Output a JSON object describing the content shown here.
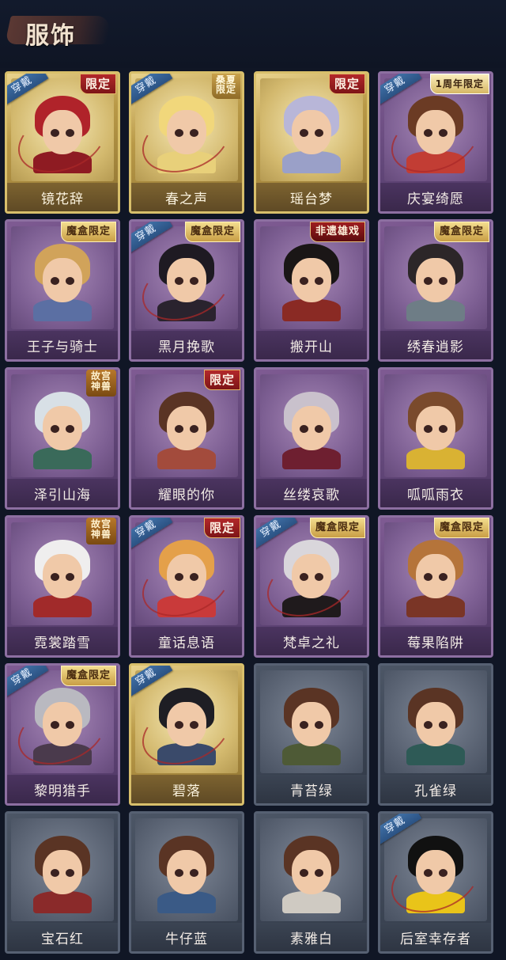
{
  "header": {
    "title": "服饰"
  },
  "labels": {
    "wear": "穿戴"
  },
  "costumes": [
    {
      "name": "镜花辞",
      "frame": "gold",
      "worn": true,
      "badge": "限定",
      "badge_style": "red",
      "hair": "#b0232a",
      "outfit": "#8e1b22"
    },
    {
      "name": "春之声",
      "frame": "gold",
      "worn": true,
      "badge": "桑夏\n限定",
      "badge_style": "multi",
      "hair": "#f1d77b",
      "outfit": "#e8d07a"
    },
    {
      "name": "瑶台梦",
      "frame": "gold",
      "worn": false,
      "badge": "限定",
      "badge_style": "red",
      "hair": "#b8b6d8",
      "outfit": "#9aa0c8"
    },
    {
      "name": "庆宴绮愿",
      "frame": "purple",
      "worn": true,
      "badge": "1周年限定",
      "badge_style": "anniv",
      "hair": "#6b3b24",
      "outfit": "#c23d34"
    },
    {
      "name": "王子与骑士",
      "frame": "purple",
      "worn": false,
      "badge": "魔盒限定",
      "badge_style": "gold",
      "hair": "#d1a35a",
      "outfit": "#5b6fa3"
    },
    {
      "name": "黑月挽歌",
      "frame": "purple",
      "worn": true,
      "badge": "魔盒限定",
      "badge_style": "gold",
      "hair": "#1e1a22",
      "outfit": "#2a232e"
    },
    {
      "name": "搬开山",
      "frame": "purple",
      "worn": false,
      "badge": "非遗雄戏",
      "badge_style": "heritage",
      "hair": "#1a1616",
      "outfit": "#8a2a24"
    },
    {
      "name": "绣春逍影",
      "frame": "purple",
      "worn": false,
      "badge": "魔盒限定",
      "badge_style": "gold",
      "hair": "#2c2628",
      "outfit": "#6e7d86"
    },
    {
      "name": "泽引山海",
      "frame": "purple",
      "worn": false,
      "badge": "故宫\n神兽",
      "badge_style": "palace",
      "hair": "#d8e0e6",
      "outfit": "#3a6a5a"
    },
    {
      "name": "耀眼的你",
      "frame": "purple",
      "worn": false,
      "badge": "限定",
      "badge_style": "red",
      "hair": "#5a3424",
      "outfit": "#a34b3c"
    },
    {
      "name": "丝缕哀歌",
      "frame": "purple",
      "worn": false,
      "badge": "",
      "badge_style": "",
      "hair": "#c9c1cc",
      "outfit": "#6e1f30"
    },
    {
      "name": "呱呱雨衣",
      "frame": "purple",
      "worn": false,
      "badge": "",
      "badge_style": "",
      "hair": "#7a4a2c",
      "outfit": "#d9b233"
    },
    {
      "name": "霓裳踏雪",
      "frame": "purple",
      "worn": false,
      "badge": "故宫\n神兽",
      "badge_style": "palace",
      "hair": "#efeeee",
      "outfit": "#a12a2a"
    },
    {
      "name": "童话息语",
      "frame": "purple",
      "worn": true,
      "badge": "限定",
      "badge_style": "red",
      "hair": "#e4a04a",
      "outfit": "#c93a3a"
    },
    {
      "name": "梵卓之礼",
      "frame": "purple",
      "worn": true,
      "badge": "魔盒限定",
      "badge_style": "gold",
      "hair": "#d9d6db",
      "outfit": "#1f1a1c"
    },
    {
      "name": "莓果陷阱",
      "frame": "purple",
      "worn": false,
      "badge": "魔盒限定",
      "badge_style": "gold",
      "hair": "#b5743a",
      "outfit": "#7a3526"
    },
    {
      "name": "黎明猎手",
      "frame": "purple",
      "worn": true,
      "badge": "魔盒限定",
      "badge_style": "gold",
      "hair": "#b9b9c0",
      "outfit": "#4a3a4c"
    },
    {
      "name": "碧落",
      "frame": "gold",
      "worn": true,
      "badge": "",
      "badge_style": "",
      "hair": "#1e1e24",
      "outfit": "#3a4a6a"
    },
    {
      "name": "青苔绿",
      "frame": "gray",
      "worn": false,
      "badge": "",
      "badge_style": "",
      "hair": "#5a3424",
      "outfit": "#4e5a36"
    },
    {
      "name": "孔雀绿",
      "frame": "gray",
      "worn": false,
      "badge": "",
      "badge_style": "",
      "hair": "#5a3424",
      "outfit": "#2e5a56"
    },
    {
      "name": "宝石红",
      "frame": "gray",
      "worn": false,
      "badge": "",
      "badge_style": "",
      "hair": "#5a3424",
      "outfit": "#8a2a2a"
    },
    {
      "name": "牛仔蓝",
      "frame": "gray",
      "worn": false,
      "badge": "",
      "badge_style": "",
      "hair": "#5a3424",
      "outfit": "#3a5a86"
    },
    {
      "name": "素雅白",
      "frame": "gray",
      "worn": false,
      "badge": "",
      "badge_style": "",
      "hair": "#5a3424",
      "outfit": "#cfcac2"
    },
    {
      "name": "后室幸存者",
      "frame": "gray",
      "worn": true,
      "badge": "",
      "badge_style": "",
      "hair": "#111",
      "outfit": "#e9c419"
    }
  ]
}
